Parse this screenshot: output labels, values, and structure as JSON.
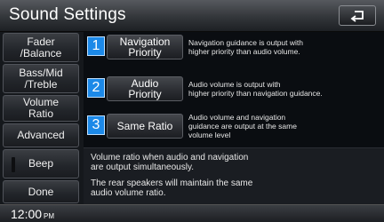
{
  "header": {
    "title": "Sound Settings",
    "back_icon": "back-arrow-icon"
  },
  "sidebar": {
    "items": [
      {
        "label": "Fader\n/Balance"
      },
      {
        "label": "Bass/Mid\n/Treble"
      },
      {
        "label": "Volume\nRatio"
      },
      {
        "label": "Advanced"
      },
      {
        "label": "Beep"
      },
      {
        "label": "Done"
      }
    ]
  },
  "options": [
    {
      "number": "1",
      "label": "Navigation\nPriority",
      "description": "Navigation guidance is output with\nhigher priority than audio volume."
    },
    {
      "number": "2",
      "label": "Audio\nPriority",
      "description": "Audio volume is output with\nhigher priority than navigation guidance."
    },
    {
      "number": "3",
      "label": "Same Ratio",
      "description": "Audio volume and navigation\nguidance are output at the same\nvolume level"
    }
  ],
  "info": {
    "line1": "Volume ratio when audio and navigation\nare output simultaneously.",
    "line2": "The rear speakers will maintain the same\naudio volume ratio."
  },
  "status": {
    "time": "12:00",
    "ampm": "PM"
  },
  "colors": {
    "accent": "#1c89e8",
    "background": "#0a0d11"
  }
}
